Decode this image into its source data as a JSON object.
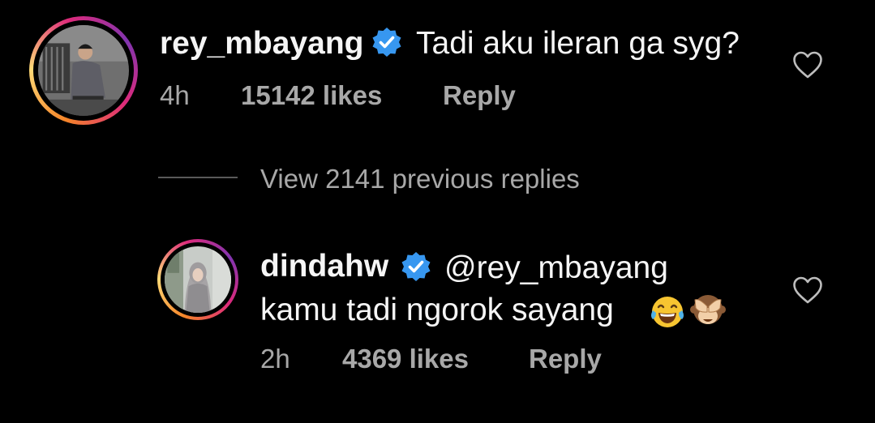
{
  "comment": {
    "username": "rey_mbayang",
    "text": "Tadi aku ileran ga syg?",
    "time": "4h",
    "likes": "15142 likes",
    "reply_label": "Reply"
  },
  "view_replies_label": "View 2141 previous replies",
  "reply": {
    "username": "dindahw",
    "mention": "@rey_mbayang",
    "text": "kamu tadi ngorok sayang",
    "emojis": [
      "tears-of-joy-emoji",
      "see-no-evil-monkey-emoji"
    ],
    "time": "2h",
    "likes": "4369 likes",
    "reply_label": "Reply"
  },
  "colors": {
    "background": "#000000",
    "primary_text": "#f5f5f5",
    "secondary_text": "#a8a8a8",
    "verified_badge": "#3797f0"
  }
}
